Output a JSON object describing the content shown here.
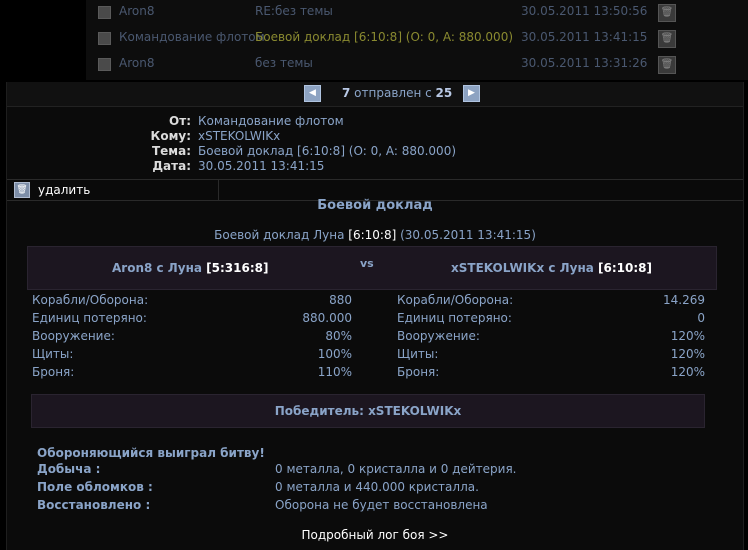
{
  "inbox": {
    "rows": [
      {
        "from": "Aron8",
        "subject": "RE:без темы",
        "date": "30.05.2011 13:50:56"
      },
      {
        "from": "Командование флотом",
        "subject": "Боевой доклад [6:10:8] (O: 0, A: 880.000)",
        "date": "30.05.2011 13:41:15"
      },
      {
        "from": "Aron8",
        "subject": "без темы",
        "date": "30.05.2011 13:31:26"
      }
    ]
  },
  "pager": {
    "current": "7",
    "middle": " отправлен с ",
    "total": "25"
  },
  "message": {
    "from_label": "От:",
    "from": "Командование флотом",
    "to_label": "Кому:",
    "to": "xSTEKOLWIKx",
    "subject_label": "Тема:",
    "subject": "Боевой доклад [6:10:8] (O: 0, A: 880.000)",
    "date_label": "Дата:",
    "date": "30.05.2011 13:41:15"
  },
  "actions": {
    "delete_label": "удалить"
  },
  "report": {
    "title": "Боевой доклад",
    "sub_prefix": "Боевой доклад Луна ",
    "sub_coord": "[6:10:8]",
    "sub_date": " (30.05.2011 13:41:15)",
    "attacker_name": "Aron8 с Луна ",
    "attacker_coord": "[5:316:8]",
    "vs": "vs",
    "defender_name": "xSTEKOLWIKx с Луна ",
    "defender_coord": "[6:10:8]",
    "stat_labels": [
      "Корабли/Оборона:",
      "Единиц потеряно:",
      "Вооружение:",
      "Щиты:",
      "Броня:"
    ],
    "attacker_stats": [
      "880",
      "880.000",
      "80%",
      "100%",
      "110%"
    ],
    "defender_stats": [
      "14.269",
      "0",
      "120%",
      "120%",
      "120%"
    ],
    "winner": "Победитель: xSTEKOLWIKx",
    "outcome": "Обороняющийся выиграл битву!",
    "loot_label": "Добыча :",
    "loot": "0 металла, 0 кристалла и 0 дейтерия.",
    "debris_label": "Поле обломков :",
    "debris": "0 металла и 440.000 кристалла.",
    "restored_label": "Восстановлено :",
    "restored": "Оборона не будет восстановлена",
    "log_link": "Подробный лог боя >>"
  }
}
